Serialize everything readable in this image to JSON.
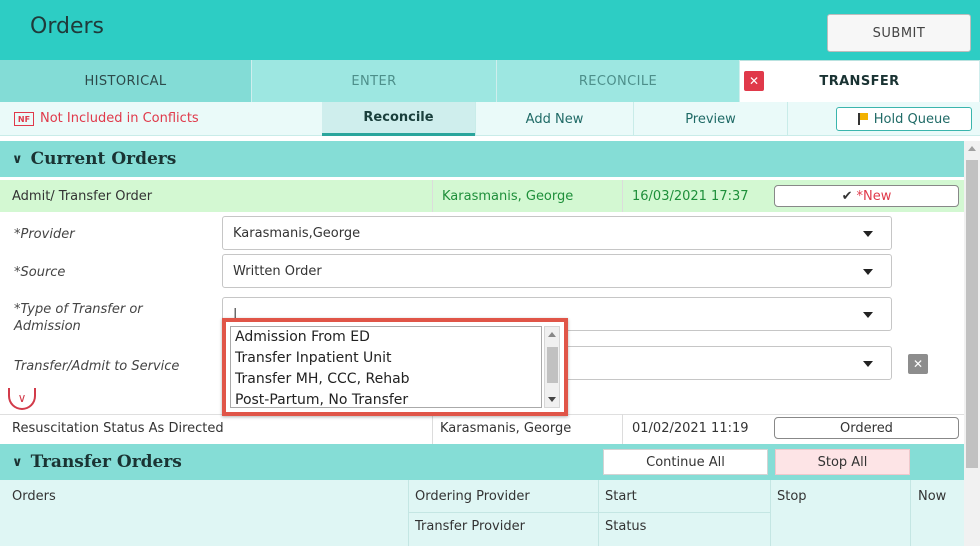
{
  "app": {
    "title": "Orders",
    "submit_label": "SUBMIT"
  },
  "tabs": [
    {
      "label": "HISTORICAL"
    },
    {
      "label": "ENTER"
    },
    {
      "label": "RECONCILE"
    },
    {
      "label": "TRANSFER",
      "active": true
    }
  ],
  "subbar": {
    "nf_badge": "NF",
    "not_included": "Not Included in Conflicts",
    "subtabs": [
      {
        "label": "Reconcile",
        "active": true
      },
      {
        "label": "Add New"
      },
      {
        "label": "Preview"
      }
    ],
    "hold_queue": "Hold Queue"
  },
  "current_orders": {
    "title": "Current Orders",
    "admit_row": {
      "label": "Admit/ Transfer Order",
      "provider": "Karasmanis, George",
      "datetime": "16/03/2021 17:37",
      "status": "*New",
      "status_check": "✔"
    },
    "form": {
      "provider_label": "*Provider",
      "provider_value": "Karasmanis,George",
      "source_label": "*Source",
      "source_value": "Written Order",
      "type_label": "*Type of Transfer or Admission",
      "type_value": "|",
      "service_label": "Transfer/Admit to Service",
      "service_value": ""
    },
    "dropdown_options": [
      "Admission From ED",
      "Transfer Inpatient Unit",
      "Transfer MH, CCC, Rehab",
      "Post-Partum, No Transfer"
    ],
    "resus_row": {
      "label": "Resuscitation Status As Directed",
      "provider": "Karasmanis, George",
      "datetime": "01/02/2021 11:19",
      "status": "Ordered"
    }
  },
  "transfer_orders": {
    "title": "Transfer Orders",
    "continue_all": "Continue All",
    "stop_all": "Stop All",
    "columns": {
      "orders": "Orders",
      "ordering_provider": "Ordering Provider",
      "transfer_provider": "Transfer Provider",
      "start": "Start",
      "status": "Status",
      "stop": "Stop",
      "now": "Now"
    }
  },
  "colors": {
    "header": "#2dcdc4",
    "accent": "#85ddd6",
    "new_row": "#d3f8d2",
    "alert": "#e0394a"
  }
}
